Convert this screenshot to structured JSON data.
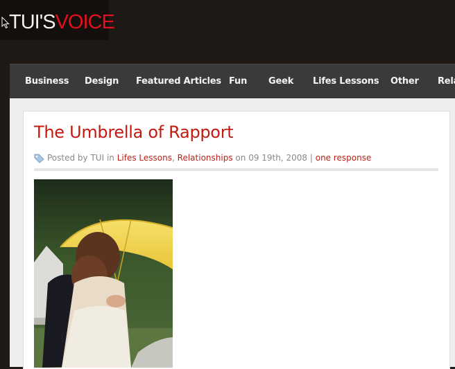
{
  "header": {
    "logo_part1": "TUI'S",
    "logo_part2": "VOICE",
    "logo_color_white": "#f2f2f2",
    "logo_color_red": "#e2101e"
  },
  "nav": {
    "items": [
      {
        "label": "Business"
      },
      {
        "label": "Design"
      },
      {
        "label": "Featured Articles"
      },
      {
        "label": "Fun"
      },
      {
        "label": "Geek"
      },
      {
        "label": "Lifes Lessons"
      },
      {
        "label": "Other"
      },
      {
        "label": "Rela"
      }
    ]
  },
  "post": {
    "title": "The Umbrella of Rapport",
    "meta": {
      "posted_by_prefix": "Posted by",
      "author": "TUI",
      "in_word": "in",
      "category1": "Lifes Lessons",
      "separator": ",",
      "category2": "Relationships",
      "on_word": "on",
      "date": "09 19th, 2008",
      "pipe": "|",
      "comments_link": "one response"
    },
    "image_icon": "photo-couple-under-yellow-umbrella"
  },
  "colors": {
    "accent_red": "#c31a10",
    "link_red": "#b9221a",
    "nav_bg": "#3a3a3a",
    "page_bg": "#1f1a16"
  }
}
